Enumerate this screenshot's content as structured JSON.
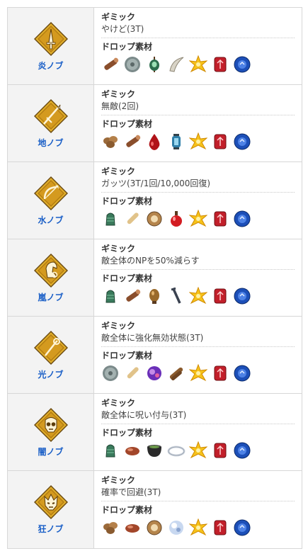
{
  "labels": {
    "gimmick": "ギミック",
    "drops": "ドロップ素材"
  },
  "rows": [
    {
      "cls": "炎ノブ",
      "emblem": "saber-icon",
      "gimmick": "やけど(3T)",
      "drops": [
        "log-icon",
        "gray-disc-icon",
        "green-gem-icon",
        "fang-icon",
        "gold-star-icon",
        "red-gem-icon",
        "blue-gem-icon"
      ]
    },
    {
      "cls": "地ノブ",
      "emblem": "lancer-icon",
      "gimmick": "無敵(2回)",
      "drops": [
        "seed-icon",
        "log-icon",
        "red-drop-icon",
        "lantern-icon",
        "gold-star-icon",
        "red-gem-icon",
        "blue-gem-icon"
      ]
    },
    {
      "cls": "水ノブ",
      "emblem": "archer-icon",
      "gimmick": "ガッツ(3T/1回/10,000回復)",
      "drops": [
        "bell-icon",
        "horn-icon",
        "shell-icon",
        "red-potion-icon",
        "gold-star-icon",
        "red-gem-icon",
        "blue-gem-icon"
      ]
    },
    {
      "cls": "嵐ノブ",
      "emblem": "rider-icon",
      "gimmick": "敵全体のNPを50%減らす",
      "drops": [
        "bell-icon",
        "log-icon",
        "egg-icon",
        "nail-icon",
        "gold-star-icon",
        "red-gem-icon",
        "blue-gem-icon"
      ]
    },
    {
      "cls": "光ノブ",
      "emblem": "caster-icon",
      "gimmick": "敵全体に強化無効状態(3T)",
      "drops": [
        "gray-disc-icon",
        "horn-icon",
        "purple-crystal-icon",
        "logs-icon",
        "gold-star-icon",
        "red-gem-icon",
        "blue-gem-icon"
      ]
    },
    {
      "cls": "闇ノブ",
      "emblem": "assassin-icon",
      "gimmick": "敵全体に呪い付与(3T)",
      "drops": [
        "bell-icon",
        "bead-icon",
        "cauldron-icon",
        "ring-icon",
        "gold-star-icon",
        "red-gem-icon",
        "blue-gem-icon"
      ]
    },
    {
      "cls": "狂ノブ",
      "emblem": "berserker-icon",
      "gimmick": "確率で回避(3T)",
      "drops": [
        "seed-icon",
        "bead-icon",
        "shell-icon",
        "ice-crystal-icon",
        "gold-star-icon",
        "red-gem-icon",
        "blue-gem-icon"
      ]
    }
  ]
}
